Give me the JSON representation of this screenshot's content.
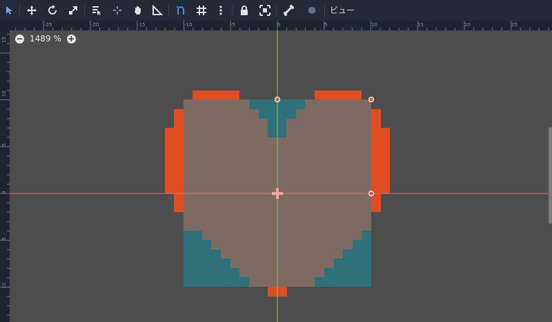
{
  "toolbar": {
    "tools": [
      {
        "icon": "select-arrow-icon",
        "active": true
      },
      {
        "icon": "move-icon"
      },
      {
        "icon": "rotate-icon"
      },
      {
        "icon": "scale-icon"
      },
      {
        "icon": "list-select-icon"
      },
      {
        "icon": "pivot-icon"
      },
      {
        "icon": "pan-hand-icon"
      },
      {
        "icon": "ruler-icon"
      },
      {
        "icon": "smart-snap-icon"
      },
      {
        "icon": "grid-snap-icon"
      },
      {
        "icon": "more-options-icon"
      },
      {
        "icon": "lock-icon"
      },
      {
        "icon": "group-icon"
      },
      {
        "icon": "skeleton-bone-icon"
      },
      {
        "icon": "camera-override-icon"
      }
    ],
    "view_menu_label": "ビュー"
  },
  "ruler": {
    "top_labels": [
      "-25",
      "-20",
      "-15",
      "-10",
      "-5",
      "0",
      "5",
      "10",
      "15",
      "20",
      "25"
    ],
    "left_labels": [
      "15",
      "10",
      "5",
      "0",
      "5",
      "10"
    ]
  },
  "zoom": {
    "minus_label": "−",
    "value": "1489 %",
    "plus_label": "+"
  },
  "colors": {
    "heart_fill": "#7d6a61",
    "outline_orange": "#e04d22",
    "teal_background": "#2f717b",
    "x_axis": "#d9716f",
    "y_axis": "#8fbf63",
    "canvas_bg": "#4d4d4d",
    "toolbar_bg": "#232a36",
    "accent_blue": "#4d8ef2"
  }
}
